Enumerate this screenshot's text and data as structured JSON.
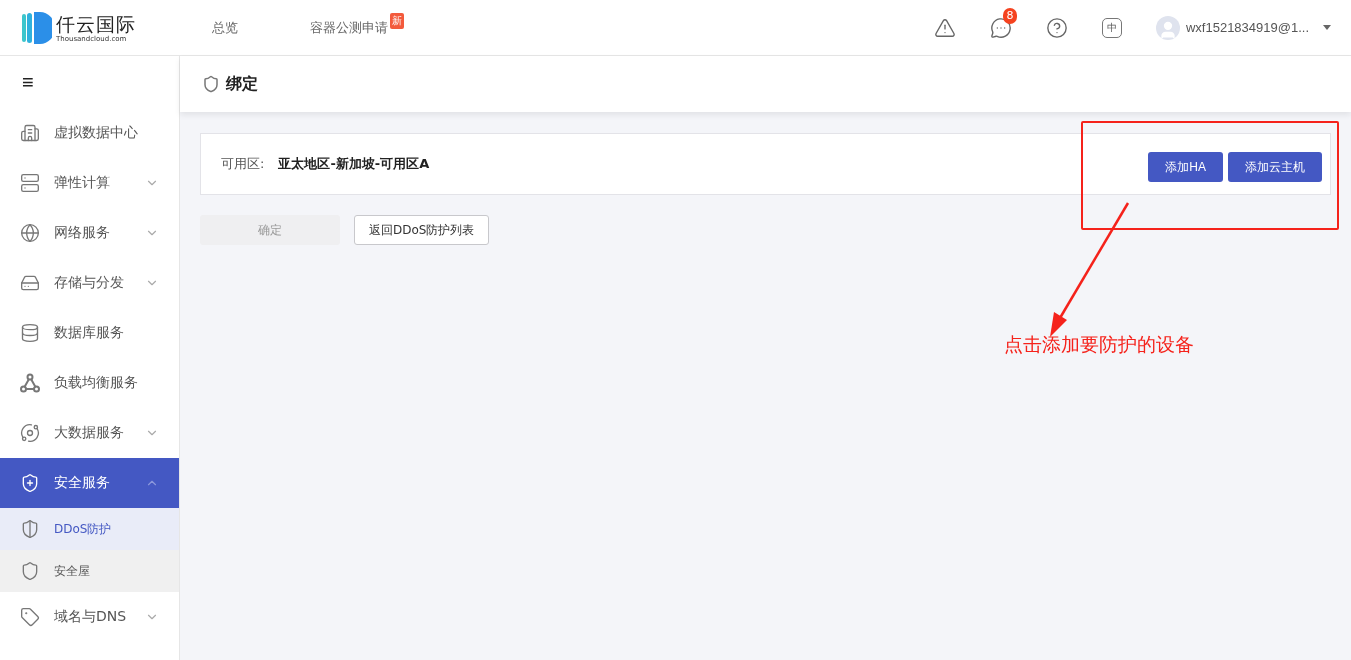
{
  "header": {
    "logo": {
      "name": "仟云国际",
      "domain": "Thousandcloud.com"
    },
    "nav": [
      {
        "label": "总览"
      },
      {
        "label": "容器公测申请",
        "badge": "新"
      }
    ],
    "notifications": "8",
    "language": "中",
    "user": "wxf1521834919@1..."
  },
  "sidebar": {
    "toggle": "≡",
    "items": [
      {
        "kind": "link",
        "label": "虚拟数据中心",
        "selected": false
      },
      {
        "kind": "group",
        "label": "弹性计算",
        "expanded": false,
        "selected": false
      },
      {
        "kind": "group",
        "label": "网络服务",
        "expanded": false,
        "selected": false
      },
      {
        "kind": "group",
        "label": "存储与分发",
        "expanded": false,
        "selected": false
      },
      {
        "kind": "link",
        "label": "数据库服务",
        "selected": false
      },
      {
        "kind": "link",
        "label": "负载均衡服务",
        "selected": false
      },
      {
        "kind": "group",
        "label": "大数据服务",
        "expanded": false,
        "selected": false
      },
      {
        "kind": "group",
        "label": "安全服务",
        "expanded": true,
        "selected": true,
        "children": [
          {
            "label": "DDoS防护",
            "selected": true,
            "hovered": false
          },
          {
            "label": "安全屋",
            "selected": false,
            "hovered": true
          }
        ]
      },
      {
        "kind": "group",
        "label": "域名与DNS",
        "expanded": false,
        "selected": false
      }
    ]
  },
  "page": {
    "title": "绑定",
    "zone": {
      "label": "可用区:",
      "value": "亚太地区-新加坡-可用区A"
    },
    "zone_buttons": [
      "添加HA",
      "添加云主机"
    ],
    "actions": [
      {
        "label": "确定",
        "disabled": true
      },
      {
        "label": "返回DDoS防护列表",
        "disabled": false
      }
    ]
  },
  "annotation": {
    "text": "点击添加要防护的设备"
  }
}
